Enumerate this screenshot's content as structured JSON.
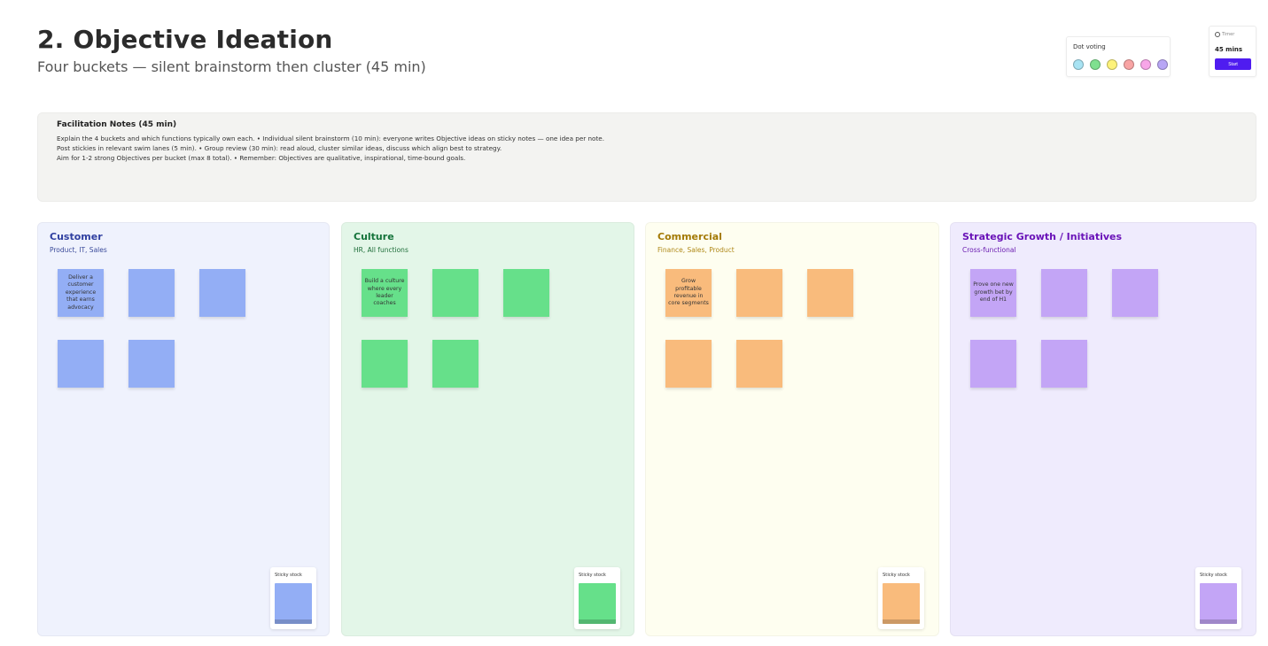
{
  "header": {
    "title": "2. Objective Ideation",
    "subtitle": "Four buckets — silent brainstorm then cluster (45 min)"
  },
  "dot_voting": {
    "label": "Dot voting",
    "dots": [
      "#a8e3f3",
      "#7fe08f",
      "#fdf27a",
      "#f8a4a4",
      "#f7a6e8",
      "#b8a6f5"
    ]
  },
  "timer": {
    "header": "Timer",
    "value": "45 mins",
    "button": "Start"
  },
  "facilitation": {
    "title": "Facilitation Notes (45 min)",
    "lines": [
      "Explain the 4 buckets and which functions typically own each.  •  Individual silent brainstorm (10 min): everyone writes Objective ideas on sticky notes — one idea per note.",
      "Post stickies in relevant swim lanes (5 min).  •  Group review (30 min): read aloud, cluster similar ideas, discuss which align best to strategy.",
      "Aim for 1-2 strong Objectives per bucket (max 8 total).  •  Remember: Objectives are qualitative, inspirational, time-bound goals."
    ]
  },
  "buckets": [
    {
      "title": "Customer",
      "subtitle": "Product, IT, Sales",
      "bg": "#eff2fd",
      "title_color": "#2f3fa0",
      "sub_color": "#3a4a9a",
      "sticky_color": "#93aef5",
      "stock_label": "Sticky stock",
      "stickies": [
        "Deliver a customer experience that earns advocacy",
        "",
        "",
        "",
        ""
      ]
    },
    {
      "title": "Culture",
      "subtitle": "HR, All functions",
      "bg": "#e3f6e8",
      "title_color": "#14733a",
      "sub_color": "#1f6e3a",
      "sticky_color": "#66e08a",
      "stock_label": "Sticky stock",
      "stickies": [
        "Build a culture where every leader coaches",
        "",
        "",
        "",
        ""
      ]
    },
    {
      "title": "Commercial",
      "subtitle": "Finance, Sales, Product",
      "bg": "#fefef0",
      "title_color": "#a47a06",
      "sub_color": "#b08a1a",
      "sticky_color": "#f9bb7c",
      "stock_label": "Sticky stock",
      "stickies": [
        "Grow profitable revenue in core segments",
        "",
        "",
        "",
        ""
      ]
    },
    {
      "title": "Strategic Growth / Initiatives",
      "subtitle": "Cross-functional",
      "bg": "#efebfd",
      "title_color": "#6a13b8",
      "sub_color": "#6a1bb0",
      "sticky_color": "#c3a5f6",
      "stock_label": "Sticky stock",
      "stickies": [
        "Prove one new growth bet by end of H1",
        "",
        "",
        "",
        ""
      ]
    }
  ]
}
